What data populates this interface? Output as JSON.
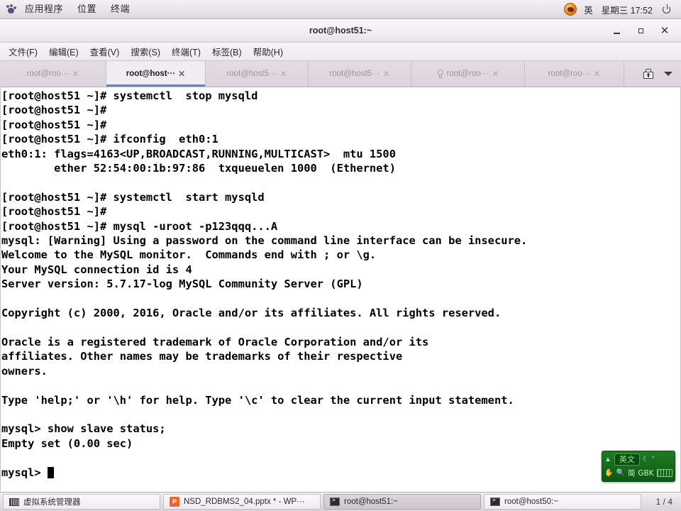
{
  "top_panel": {
    "menus": [
      "应用程序",
      "位置",
      "终端"
    ],
    "ime_indicator": "英",
    "clock": "星期三 17:52",
    "foot_icon": "gnome-foot-icon",
    "power_icon": "power-icon"
  },
  "window": {
    "title": "root@host51:~",
    "minimize": "—",
    "maximize": "▫",
    "close": "✕"
  },
  "menu_bar": {
    "items": [
      "文件(F)",
      "编辑(E)",
      "查看(V)",
      "搜索(S)",
      "终端(T)",
      "标签(B)",
      "帮助(H)"
    ]
  },
  "tab_bar": {
    "tabs": [
      {
        "label": "root@roo···",
        "active": false,
        "close": "✕",
        "bell": false
      },
      {
        "label": "root@host···",
        "active": true,
        "close": "✕",
        "bell": false
      },
      {
        "label": "root@host5···",
        "active": false,
        "close": "✕",
        "bell": false
      },
      {
        "label": "root@host5···",
        "active": false,
        "close": "✕",
        "bell": false
      },
      {
        "label": "root@roo···",
        "active": false,
        "close": "✕",
        "bell": true
      },
      {
        "label": "root@roo···",
        "active": false,
        "close": "✕",
        "bell": false
      }
    ],
    "new_tab_icon": "new-tab-icon",
    "tab_list_icon": "chevron-down-icon",
    "active_underline_color": "#4a90d9"
  },
  "terminal": {
    "background": "#ffffff",
    "foreground": "#000000",
    "lines": [
      "[root@host51 ~]# systemctl  stop mysqld",
      "[root@host51 ~]#",
      "[root@host51 ~]#",
      "[root@host51 ~]# ifconfig  eth0:1",
      "eth0:1: flags=4163<UP,BROADCAST,RUNNING,MULTICAST>  mtu 1500",
      "        ether 52:54:00:1b:97:86  txqueuelen 1000  (Ethernet)",
      "",
      "[root@host51 ~]# systemctl  start mysqld",
      "[root@host51 ~]#",
      "[root@host51 ~]# mysql -uroot -p123qqq...A",
      "mysql: [Warning] Using a password on the command line interface can be insecure.",
      "Welcome to the MySQL monitor.  Commands end with ; or \\g.",
      "Your MySQL connection id is 4",
      "Server version: 5.7.17-log MySQL Community Server (GPL)",
      "",
      "Copyright (c) 2000, 2016, Oracle and/or its affiliates. All rights reserved.",
      "",
      "Oracle is a registered trademark of Oracle Corporation and/or its",
      "affiliates. Other names may be trademarks of their respective",
      "owners.",
      "",
      "Type 'help;' or '\\h' for help. Type '\\c' to clear the current input statement.",
      "",
      "mysql> show slave status;",
      "Empty set (0.00 sec)",
      "",
      "mysql> "
    ]
  },
  "ime_panel": {
    "mode": "英文",
    "up_icon": "chevron-up-icon",
    "moon_icon": "moon-icon",
    "quote_icon": "quote-icon",
    "hand_icon": "hand-icon",
    "search_icon": "search-icon",
    "script": "简",
    "encoding": "GBK",
    "keyboard_icon": "keyboard-icon",
    "accent": "#1f7a24"
  },
  "taskbar": {
    "items": [
      {
        "label": "虚拟系统管理器",
        "icon": "vm-manager-icon",
        "active": false
      },
      {
        "label": "NSD_RDBMS2_04.pptx * - WP···",
        "icon": "wps-presentation-icon",
        "active": false
      },
      {
        "label": "root@host51:~",
        "icon": "terminal-icon",
        "active": true
      },
      {
        "label": "root@host50:~",
        "icon": "terminal-icon",
        "active": false
      }
    ],
    "workspace": "1 / 4"
  }
}
